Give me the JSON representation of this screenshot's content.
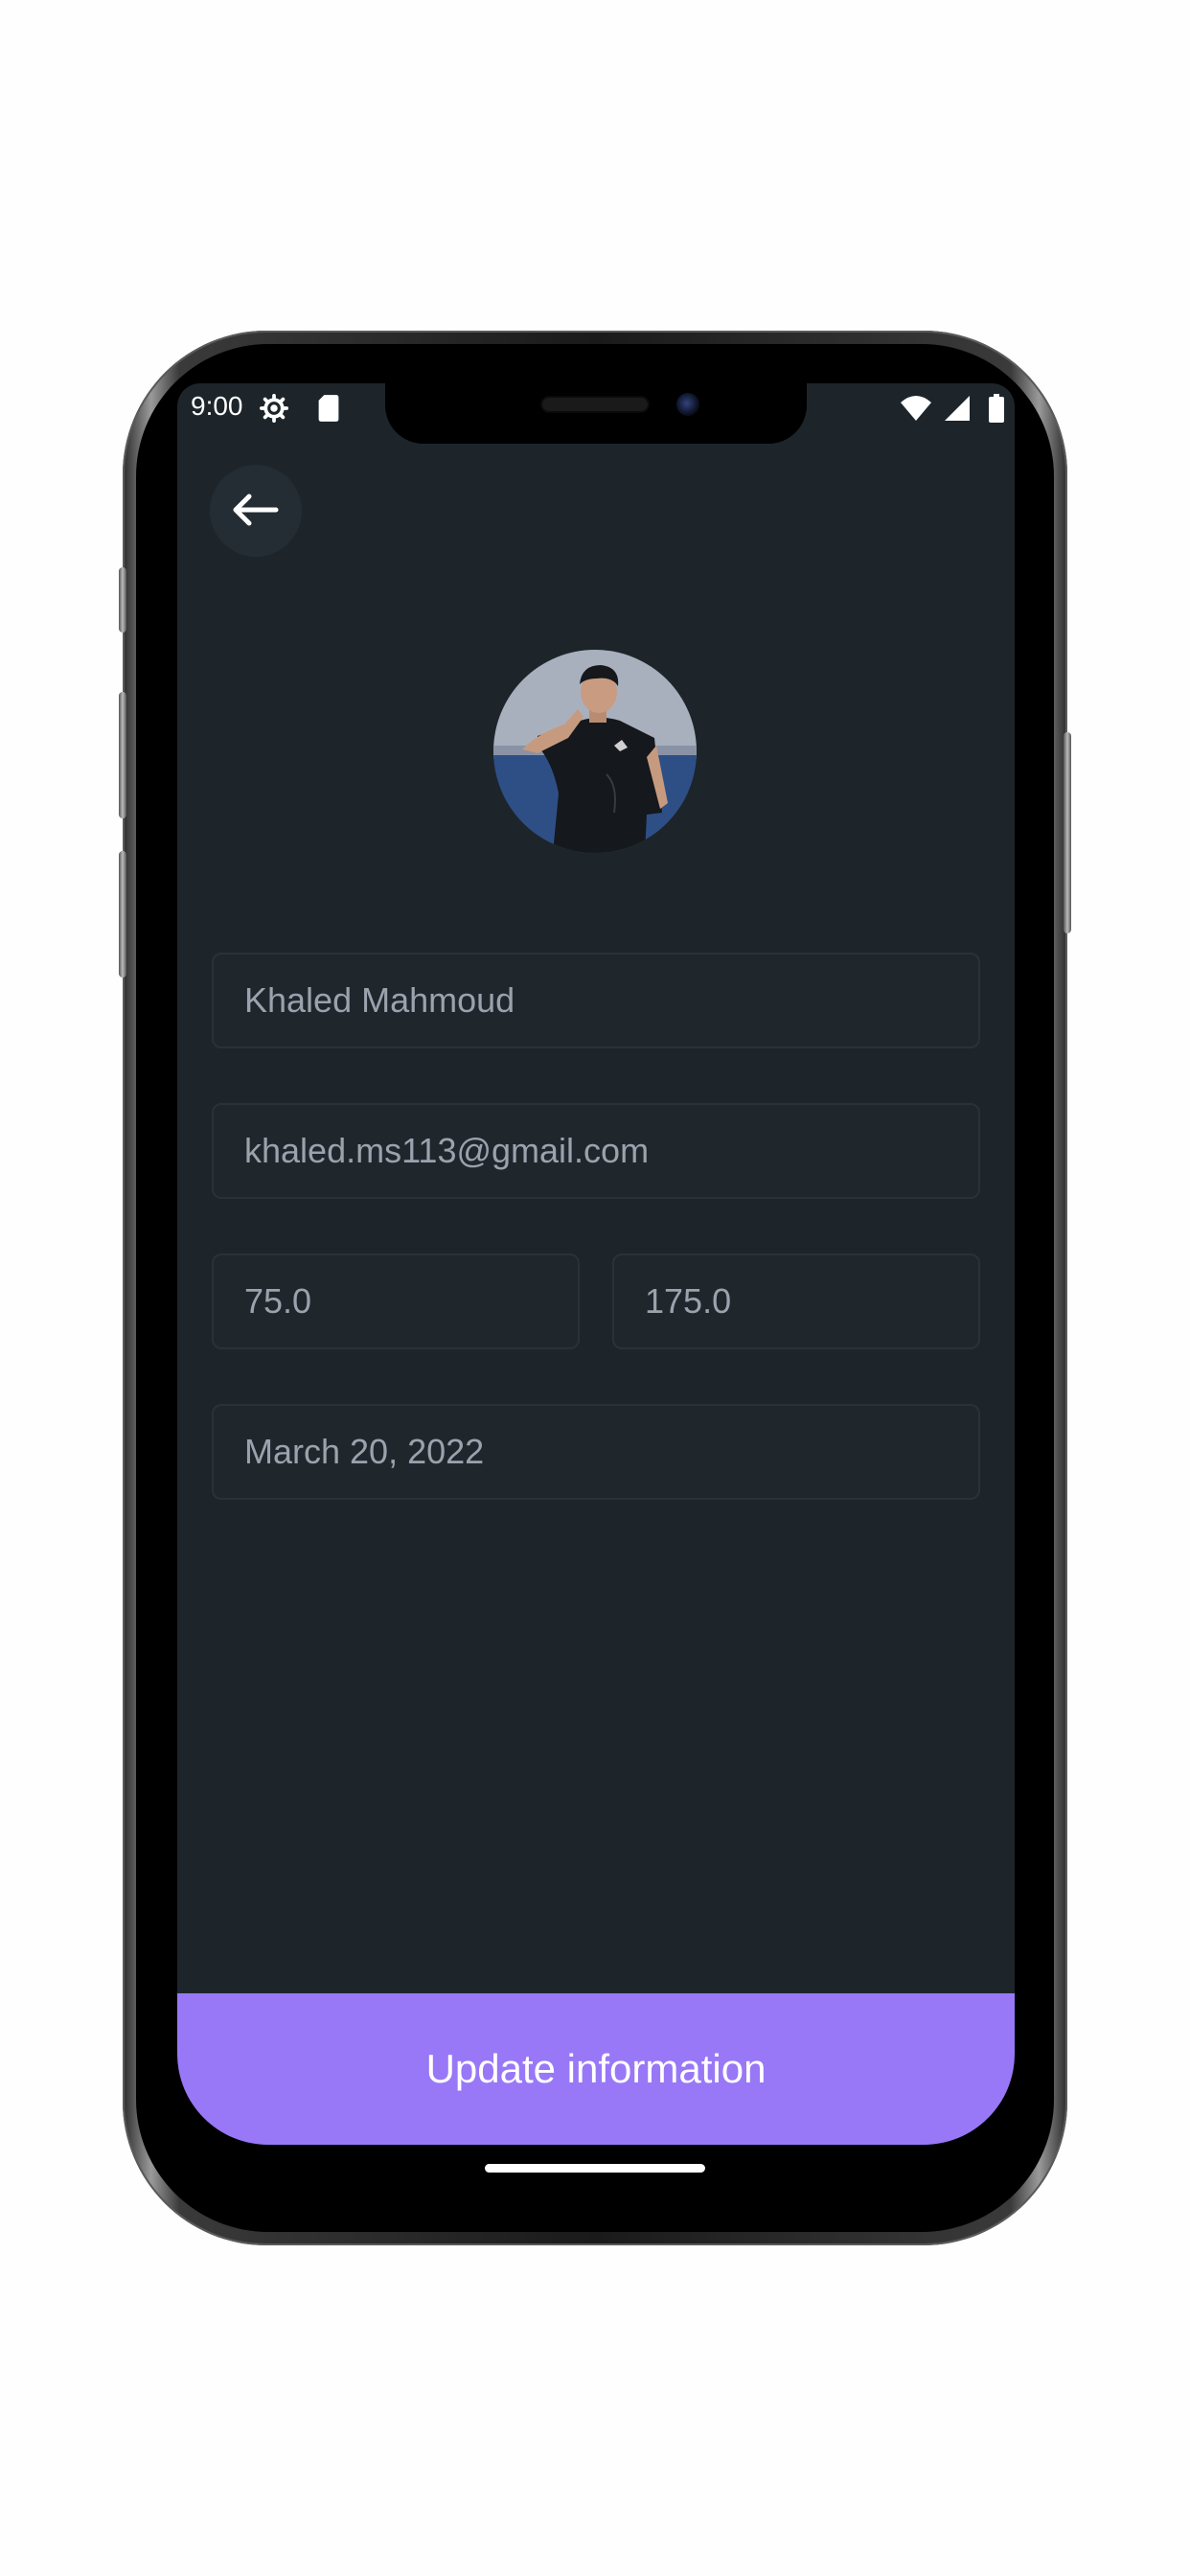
{
  "status_bar": {
    "time": "9:00",
    "left_icons": [
      "settings-gear-icon",
      "sd-card-icon"
    ],
    "right_icons": [
      "wifi-icon",
      "cell-signal-icon",
      "battery-icon"
    ]
  },
  "header": {
    "back_icon": "arrow-left-icon"
  },
  "profile": {
    "avatar_icon": "profile-photo"
  },
  "form": {
    "name_value": "Khaled Mahmoud",
    "email_value": "khaled.ms113@gmail.com",
    "weight_value": "75.0",
    "height_value": "175.0",
    "date_value": "March 20, 2022"
  },
  "actions": {
    "update_label": "Update information"
  },
  "colors": {
    "background": "#1d252b",
    "field_bg": "#1f272d",
    "field_border": "#29323a",
    "field_text": "#9aa3ad",
    "accent": "#9878f7"
  }
}
